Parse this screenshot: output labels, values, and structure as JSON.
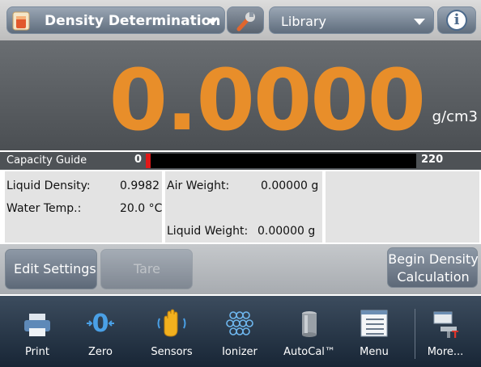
{
  "topbar": {
    "app_title": "Density Determination",
    "library_label": "Library",
    "icons": {
      "app": "density-app-icon",
      "settings": "wrench-icon",
      "info": "info-icon"
    }
  },
  "display": {
    "reading": "0.0000",
    "unit": "g/cm3",
    "reading_color": "#e88e2a"
  },
  "capacity_guide": {
    "label": "Capacity Guide",
    "min": "0",
    "max": "220",
    "fill_color": "#e01818"
  },
  "results": {
    "liquid_density_label": "Liquid Density:",
    "liquid_density_value": "0.9982",
    "water_temp_label": "Water Temp.:",
    "water_temp_value": "20.0 °C",
    "air_weight_label": "Air Weight:",
    "air_weight_value": "0.00000 g",
    "liquid_weight_label": "Liquid Weight:",
    "liquid_weight_value": "0.00000 g"
  },
  "actions": {
    "edit_settings": "Edit Settings",
    "tare": "Tare",
    "begin_line1": "Begin Density",
    "begin_line2": "Calculation"
  },
  "toolbar": [
    {
      "label": "Print",
      "icon": "printer-icon"
    },
    {
      "label": "Zero",
      "icon": "zero-icon"
    },
    {
      "label": "Sensors",
      "icon": "hand-sensor-icon"
    },
    {
      "label": "Ionizer",
      "icon": "ionizer-icon"
    },
    {
      "label": "AutoCal™",
      "icon": "calibration-weight-icon"
    },
    {
      "label": "Menu",
      "icon": "menu-icon"
    },
    {
      "label": "More...",
      "icon": "more-icon"
    }
  ]
}
